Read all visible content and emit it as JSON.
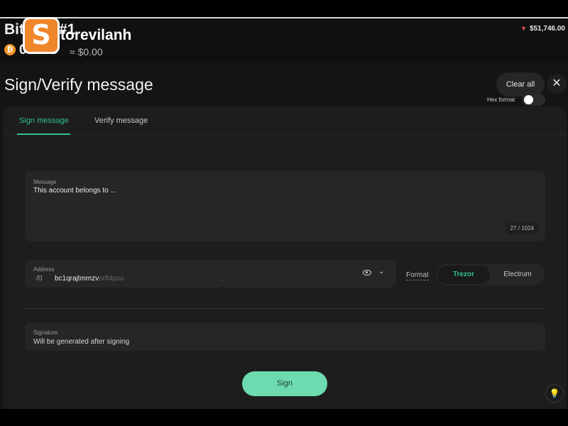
{
  "header": {
    "account_name": "Bitcoin #1",
    "balance_btc": "0 BTC",
    "balance_fiat": "≈ $0.00",
    "price": "$51,746.00",
    "coin_icon": "bitcoin-icon"
  },
  "watermark": {
    "letter": "S",
    "text": "torevilanh"
  },
  "page": {
    "title": "Sign/Verify message",
    "clear_label": "Clear all",
    "close_symbol": "✕"
  },
  "tabs": [
    {
      "label": "Sign message",
      "active": true
    },
    {
      "label": "Verify message",
      "active": false
    }
  ],
  "hex_format": {
    "label": "Hex format",
    "enabled": false
  },
  "message": {
    "label": "Message",
    "value": "This account belongs to ...",
    "char_count": "27 / 1024"
  },
  "address": {
    "label": "Address",
    "path": "/0",
    "value_visible": "bc1qrajtmmzv",
    "value_faded": "srft4psu",
    "tail": "."
  },
  "format": {
    "label": "Format",
    "options": [
      "Trezor",
      "Electrum"
    ],
    "selected": "Trezor"
  },
  "signature": {
    "label": "Signature",
    "value": "Will be generated after signing"
  },
  "sign_button": "Sign",
  "colors": {
    "accent": "#33c08b",
    "sign_button": "#6ddab0",
    "price_down": "#e5534b",
    "btc": "#f39321"
  }
}
